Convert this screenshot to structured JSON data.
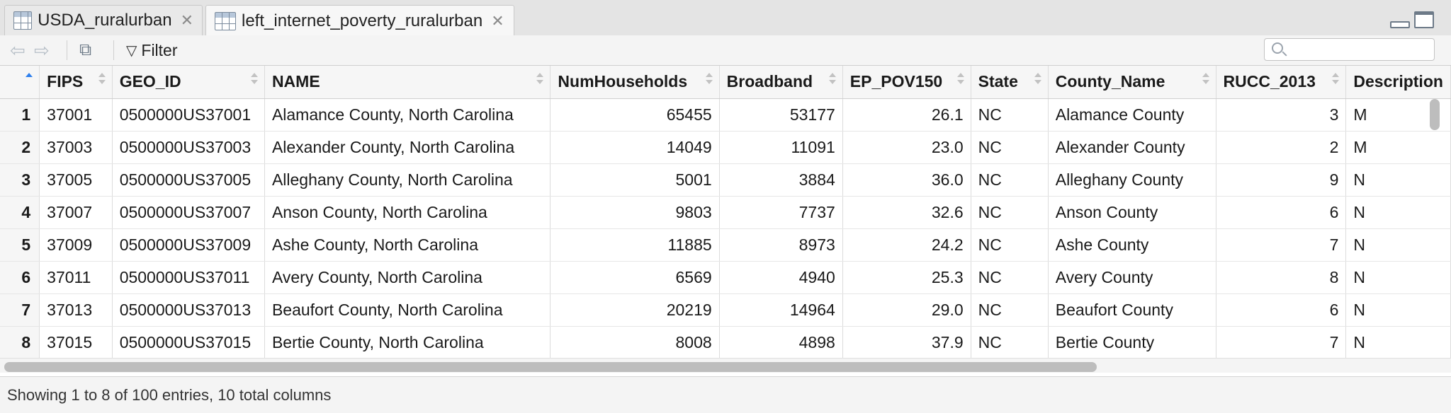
{
  "tabs": [
    {
      "label": "USDA_ruralurban",
      "active": false
    },
    {
      "label": "left_internet_poverty_ruralurban",
      "active": true
    }
  ],
  "toolbar": {
    "filter_label": "Filter",
    "search_placeholder": ""
  },
  "table": {
    "columns": [
      "FIPS",
      "GEO_ID",
      "NAME",
      "NumHouseholds",
      "Broadband",
      "EP_POV150",
      "State",
      "County_Name",
      "RUCC_2013",
      "Description"
    ],
    "rows": [
      {
        "n": "1",
        "cells": [
          "37001",
          "0500000US37001",
          "Alamance County, North Carolina",
          "65455",
          "53177",
          "26.1",
          "NC",
          "Alamance County",
          "3",
          "M"
        ]
      },
      {
        "n": "2",
        "cells": [
          "37003",
          "0500000US37003",
          "Alexander County, North Carolina",
          "14049",
          "11091",
          "23.0",
          "NC",
          "Alexander County",
          "2",
          "M"
        ]
      },
      {
        "n": "3",
        "cells": [
          "37005",
          "0500000US37005",
          "Alleghany County, North Carolina",
          "5001",
          "3884",
          "36.0",
          "NC",
          "Alleghany County",
          "9",
          "N"
        ]
      },
      {
        "n": "4",
        "cells": [
          "37007",
          "0500000US37007",
          "Anson County, North Carolina",
          "9803",
          "7737",
          "32.6",
          "NC",
          "Anson County",
          "6",
          "N"
        ]
      },
      {
        "n": "5",
        "cells": [
          "37009",
          "0500000US37009",
          "Ashe County, North Carolina",
          "11885",
          "8973",
          "24.2",
          "NC",
          "Ashe County",
          "7",
          "N"
        ]
      },
      {
        "n": "6",
        "cells": [
          "37011",
          "0500000US37011",
          "Avery County, North Carolina",
          "6569",
          "4940",
          "25.3",
          "NC",
          "Avery County",
          "8",
          "N"
        ]
      },
      {
        "n": "7",
        "cells": [
          "37013",
          "0500000US37013",
          "Beaufort County, North Carolina",
          "20219",
          "14964",
          "29.0",
          "NC",
          "Beaufort County",
          "6",
          "N"
        ]
      },
      {
        "n": "8",
        "cells": [
          "37015",
          "0500000US37015",
          "Bertie County, North Carolina",
          "8008",
          "4898",
          "37.9",
          "NC",
          "Bertie County",
          "7",
          "N"
        ]
      }
    ]
  },
  "status": {
    "text": "Showing 1 to 8 of 100 entries, 10 total columns"
  }
}
